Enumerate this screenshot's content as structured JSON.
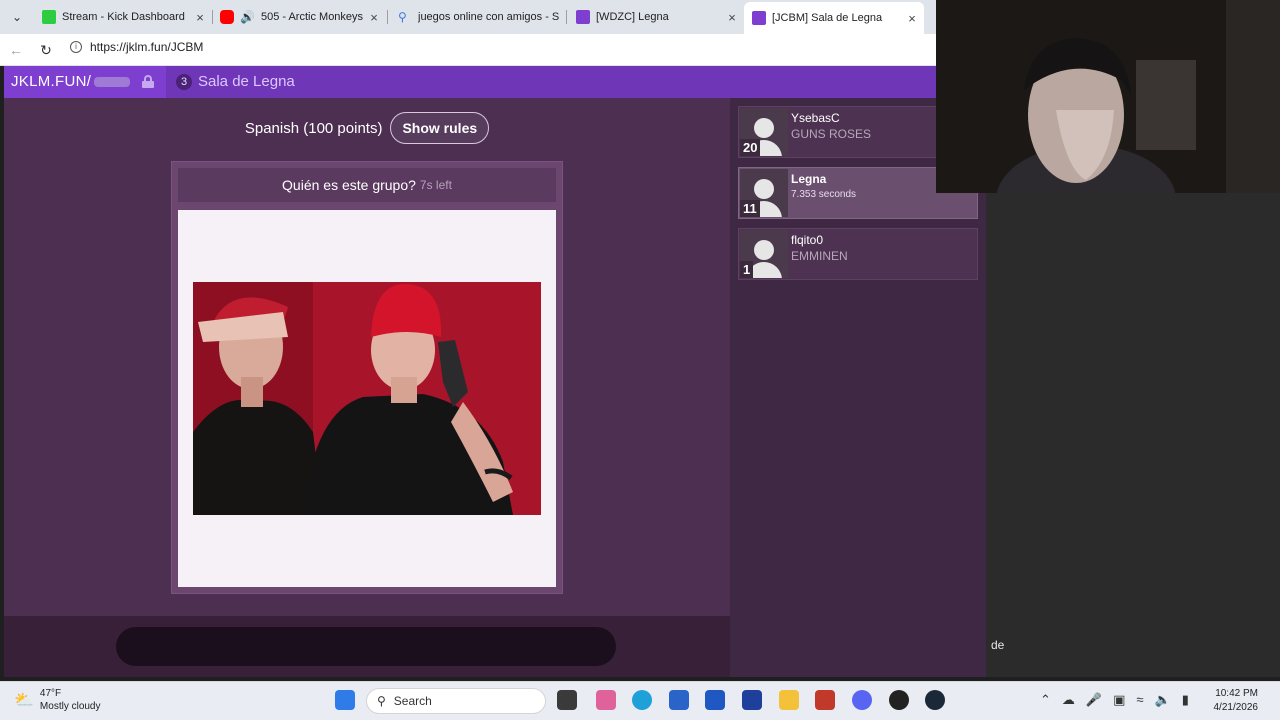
{
  "browser": {
    "tabs": [
      {
        "label": "Stream - Kick Dashboard",
        "icon": "kick-icon",
        "color": "#2ecc40"
      },
      {
        "label": "505 - Arctic Monkeys - Y",
        "icon": "youtube-icon",
        "color": "#ff0000"
      },
      {
        "label": "juegos online con amigos - S",
        "icon": "search-icon",
        "color": "#3c7be0"
      },
      {
        "label": "[WDZC] Legna",
        "icon": "jklm-icon",
        "color": "#7e3ed0"
      },
      {
        "label": "[JCBM] Sala de Legna",
        "icon": "jklm-icon",
        "color": "#7e3ed0"
      }
    ],
    "url": "https://jklm.fun/JCBM"
  },
  "page": {
    "brand": "JKLM.FUN/",
    "player_count": "3",
    "room_name": "Sala de Legna",
    "rule_text": "Spanish (100 points)",
    "show_rules_label": "Show rules",
    "prompt": "Quién es este grupo?",
    "timer": "7s left",
    "accent_color": "#7e3ed0"
  },
  "players": [
    {
      "name": "YsebasC",
      "guess": "GUNS ROSES",
      "score": "20"
    },
    {
      "name": "Legna",
      "guess": "7.353 seconds",
      "score": "11"
    },
    {
      "name": "flqito0",
      "guess": "EMMINEN",
      "score": "1"
    }
  ],
  "chat": {
    "text": "de"
  },
  "taskbar": {
    "temperature": "47°F",
    "weather": "Mostly cloudy",
    "search_label": "Search",
    "time": "10:42 PM",
    "date": "4/21/2026"
  }
}
